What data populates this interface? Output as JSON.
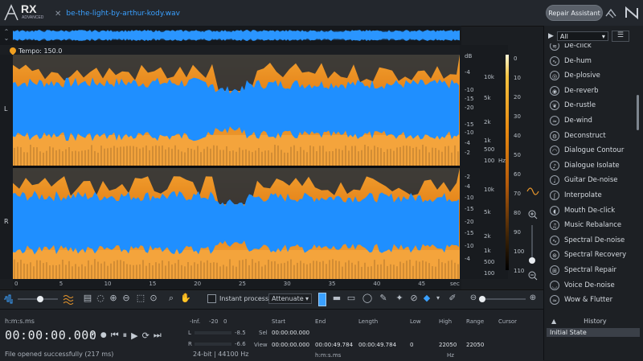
{
  "app": {
    "logo": "RX",
    "logo_sub": "ADVANCED",
    "file_tab": "be-the-light-by-arthur-kody.wav",
    "repair_assistant": "Repair Assistant"
  },
  "tempo": "Tempo: 150.0",
  "channels": [
    "L",
    "R"
  ],
  "freq_scale": {
    "L": {
      "db": "dB",
      "left": [
        "-4",
        "-10",
        "-15",
        "-20",
        "-15",
        "-10",
        "-4",
        "-2"
      ],
      "right": [
        "10k",
        "5k",
        "2k",
        "1k",
        "500",
        "100"
      ]
    },
    "R": {
      "left": [
        "-2",
        "-4",
        "-10",
        "-15",
        "-20",
        "-15",
        "-10",
        "-4"
      ],
      "right": [
        "10k",
        "5k",
        "2k",
        "1k",
        "500",
        "100"
      ]
    },
    "unit": "Hz"
  },
  "color_scale": [
    "0",
    "10",
    "20",
    "30",
    "40",
    "50",
    "60",
    "70",
    "80",
    "90",
    "100",
    "110"
  ],
  "time_ruler": [
    "0",
    "5",
    "10",
    "15",
    "20",
    "25",
    "30",
    "35",
    "40",
    "45",
    "sec"
  ],
  "toolbar": {
    "instant_process": "Instant process",
    "attenuate": "Attenuate"
  },
  "bottom": {
    "format": "h:m:s.ms",
    "timecode": "00:00:00.000",
    "status": "File opened successfully (217 ms)",
    "meter": {
      "inf": "-Inf.",
      "m20": "-20",
      "zero": "0",
      "L": "L",
      "R": "R",
      "Lval": "-8.5",
      "Rval": "-6.6"
    },
    "file_format": "24-bit | 44100 Hz",
    "selection": {
      "start": "Start",
      "end": "End",
      "length": "Length",
      "low": "Low",
      "high": "High",
      "range": "Range",
      "cursor": "Cursor",
      "sel": "Sel",
      "view": "View",
      "sel_start": "00:00:00.000",
      "view_start": "00:00:00.000",
      "view_end": "00:00:49.784",
      "view_length": "00:00:49.784",
      "view_low": "0",
      "view_high": "22050",
      "view_range": "22050",
      "time_unit": "h:m:s.ms",
      "freq_unit": "Hz"
    }
  },
  "right_panel": {
    "filter": "All",
    "modules": [
      {
        "label": "De-click",
        "icon": "de-click-icon"
      },
      {
        "label": "De-hum",
        "icon": "de-hum-icon"
      },
      {
        "label": "De-plosive",
        "icon": "de-plosive-icon"
      },
      {
        "label": "De-reverb",
        "icon": "de-reverb-icon"
      },
      {
        "label": "De-rustle",
        "icon": "de-rustle-icon"
      },
      {
        "label": "De-wind",
        "icon": "de-wind-icon"
      },
      {
        "label": "Deconstruct",
        "icon": "deconstruct-icon"
      },
      {
        "label": "Dialogue Contour",
        "icon": "dialogue-contour-icon"
      },
      {
        "label": "Dialogue Isolate",
        "icon": "dialogue-isolate-icon"
      },
      {
        "label": "Guitar De-noise",
        "icon": "guitar-de-noise-icon"
      },
      {
        "label": "Interpolate",
        "icon": "interpolate-icon"
      },
      {
        "label": "Mouth De-click",
        "icon": "mouth-de-click-icon"
      },
      {
        "label": "Music Rebalance",
        "icon": "music-rebalance-icon"
      },
      {
        "label": "Spectral De-noise",
        "icon": "spectral-de-noise-icon"
      },
      {
        "label": "Spectral Recovery",
        "icon": "spectral-recovery-icon"
      },
      {
        "label": "Spectral Repair",
        "icon": "spectral-repair-icon"
      },
      {
        "label": "Voice De-noise",
        "icon": "voice-de-noise-icon"
      },
      {
        "label": "Wow & Flutter",
        "icon": "wow-flutter-icon"
      }
    ],
    "history_title": "History",
    "history": [
      "Initial State"
    ]
  },
  "colors": {
    "waveform": "#1f8fff",
    "spectrogram_hot": "#f0951f",
    "spectrogram_dark": "#1a1410",
    "accent": "#3aa0ff"
  }
}
